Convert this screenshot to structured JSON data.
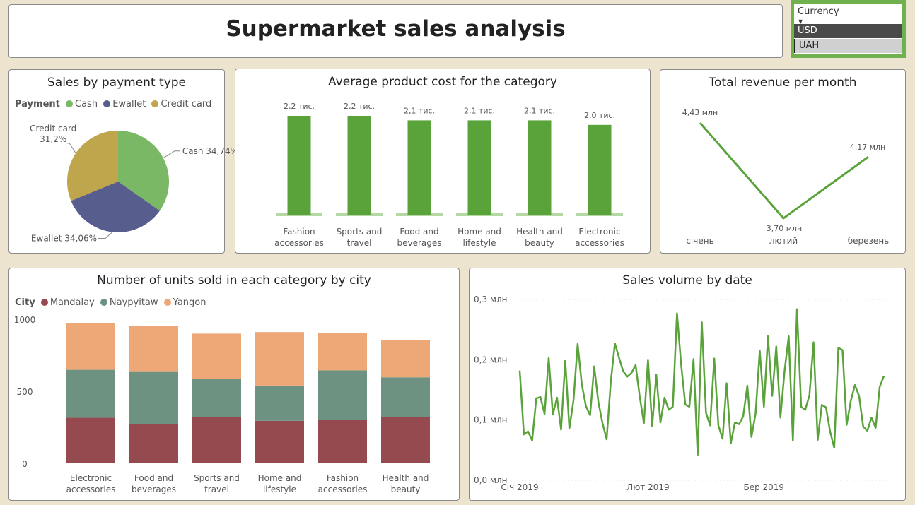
{
  "header": {
    "title": "Supermarket sales analysis"
  },
  "currency": {
    "label": "Currency",
    "options": [
      "USD",
      "UAH"
    ],
    "selected": "USD"
  },
  "colors": {
    "green": "#5aa33a",
    "green_light": "#b5d8a5",
    "cash": "#7ab865",
    "ewallet": "#575d8c",
    "credit": "#bfa54c",
    "mandalay": "#954a50",
    "naypyitaw": "#6e9282",
    "yangon": "#eea776"
  },
  "chart_data": [
    {
      "id": "payment",
      "type": "pie",
      "title": "Sales by payment type",
      "legend_title": "Payment",
      "legend": [
        "Cash",
        "Ewallet",
        "Credit card"
      ],
      "labels": [
        "Cash",
        "Ewallet",
        "Credit card"
      ],
      "values": [
        34.74,
        34.06,
        31.2
      ],
      "value_labels": [
        "34,74%",
        "34,06%",
        "31,2%"
      ],
      "legend_position": "top-left"
    },
    {
      "id": "avgcost",
      "type": "bar",
      "title": "Average product cost for the category",
      "categories": [
        "Fashion accessories",
        "Sports and travel",
        "Food and beverages",
        "Home and lifestyle",
        "Health and beauty",
        "Electronic accessories"
      ],
      "values": [
        2.2,
        2.2,
        2.1,
        2.1,
        2.1,
        2.0
      ],
      "value_labels": [
        "2,2 тис.",
        "2,2 тис.",
        "2,1 тис.",
        "2,1 тис.",
        "2,1 тис.",
        "2,0 тис."
      ]
    },
    {
      "id": "revenue",
      "type": "line",
      "title": "Total revenue per month",
      "x": [
        "січень",
        "лютий",
        "березень"
      ],
      "values": [
        4.43,
        3.7,
        4.17
      ],
      "value_labels": [
        "4,43 млн",
        "3,70 млн",
        "4,17 млн"
      ]
    },
    {
      "id": "units",
      "type": "bar",
      "stacked": true,
      "title": "Number of units sold in each category by city",
      "legend_title": "City",
      "categories": [
        "Electronic accessories",
        "Food and beverages",
        "Sports and travel",
        "Home and lifestyle",
        "Fashion accessories",
        "Health and beauty"
      ],
      "series": [
        {
          "name": "Mandalay",
          "values": [
            316,
            270,
            322,
            295,
            303,
            320
          ]
        },
        {
          "name": "Naypyitaw",
          "values": [
            333,
            369,
            265,
            245,
            342,
            277
          ]
        },
        {
          "name": "Yangon",
          "values": [
            322,
            313,
            313,
            371,
            257,
            257
          ]
        }
      ],
      "yticks": [
        "0",
        "500",
        "1000"
      ],
      "ylim": [
        0,
        1000
      ],
      "legend_position": "top-left"
    },
    {
      "id": "volume",
      "type": "line",
      "title": "Sales volume by date",
      "x_start": "Січ 2019",
      "xticks": [
        "Січ 2019",
        "Лют 2019",
        "Бер 2019"
      ],
      "yticks": [
        "0,0 млн",
        "0,1 млн",
        "0,2 млн",
        "0,3 млн"
      ],
      "ylim": [
        0,
        0.3
      ],
      "values": [
        0.182,
        0.076,
        0.081,
        0.066,
        0.136,
        0.138,
        0.11,
        0.203,
        0.109,
        0.137,
        0.084,
        0.199,
        0.086,
        0.133,
        0.226,
        0.159,
        0.123,
        0.108,
        0.189,
        0.13,
        0.095,
        0.068,
        0.164,
        0.227,
        0.203,
        0.181,
        0.172,
        0.178,
        0.191,
        0.139,
        0.095,
        0.2,
        0.09,
        0.175,
        0.096,
        0.137,
        0.117,
        0.122,
        0.277,
        0.193,
        0.126,
        0.122,
        0.201,
        0.042,
        0.262,
        0.112,
        0.091,
        0.202,
        0.091,
        0.069,
        0.161,
        0.061,
        0.096,
        0.093,
        0.106,
        0.157,
        0.072,
        0.111,
        0.215,
        0.122,
        0.239,
        0.14,
        0.222,
        0.104,
        0.181,
        0.239,
        0.066,
        0.284,
        0.122,
        0.117,
        0.141,
        0.229,
        0.067,
        0.125,
        0.121,
        0.081,
        0.054,
        0.22,
        0.216,
        0.092,
        0.132,
        0.158,
        0.14,
        0.089,
        0.082,
        0.104,
        0.087,
        0.155,
        0.173
      ]
    }
  ]
}
